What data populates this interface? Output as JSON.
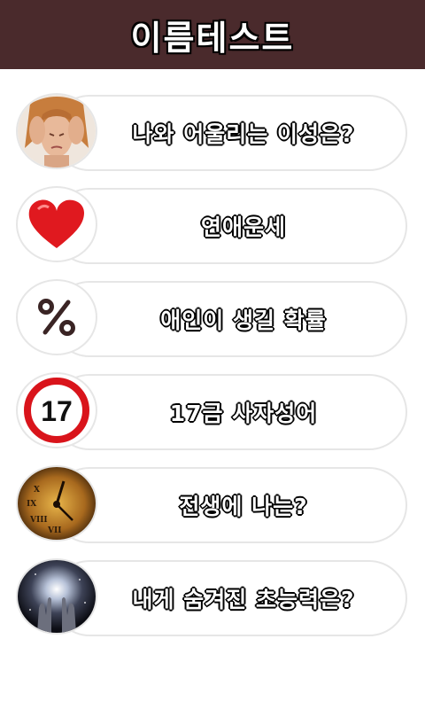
{
  "header": {
    "title": "이름테스트"
  },
  "menu": [
    {
      "label": "나와 어울리는 이성은?",
      "icon": "stressed-woman-photo-icon"
    },
    {
      "label": "연애운세",
      "icon": "heart-icon"
    },
    {
      "label": "애인이 생길 확률",
      "icon": "percent-icon"
    },
    {
      "label": "17금 사자성어",
      "icon": "age-17-sign-icon",
      "icon_text": "17"
    },
    {
      "label": "전생에 나는?",
      "icon": "old-clock-icon"
    },
    {
      "label": "내게 숨겨진 초능력은?",
      "icon": "magic-hands-galaxy-icon"
    }
  ],
  "colors": {
    "header_bg": "#4a2a2c",
    "pill_border": "#e6e6e6",
    "heart": "#e0191f",
    "sign_ring": "#d9141b"
  }
}
